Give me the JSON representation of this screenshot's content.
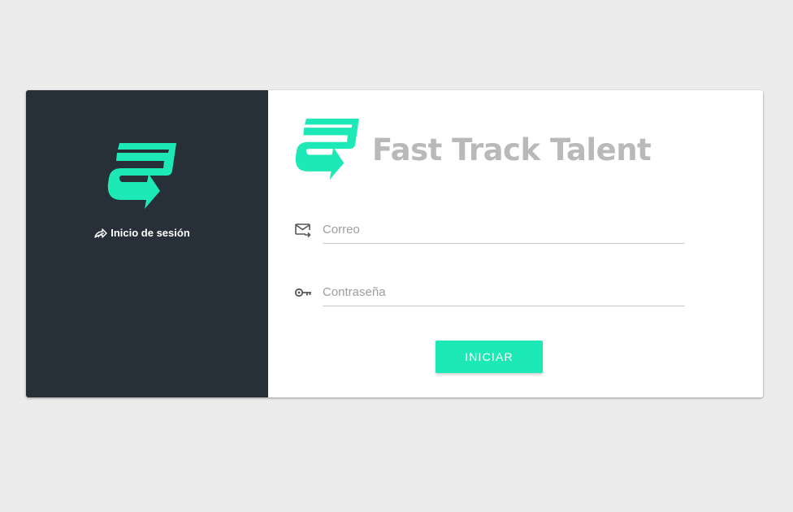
{
  "colors": {
    "accent": "#1de9b6",
    "sidebar_bg": "#273038",
    "page_bg": "#ececec",
    "brand_text": "#b9b9b9"
  },
  "sidebar": {
    "logo_icon": "fast-track-logo-icon",
    "title_icon": "login-arrow-icon",
    "title": "Inicio de sesión"
  },
  "brand": {
    "logo_icon": "fast-track-logo-icon",
    "name": "Fast Track Talent"
  },
  "form": {
    "email": {
      "icon": "email-forward-icon",
      "placeholder": "Correo",
      "value": ""
    },
    "password": {
      "icon": "key-icon",
      "placeholder": "Contraseña",
      "value": ""
    },
    "submit_label": "INICIAR"
  }
}
